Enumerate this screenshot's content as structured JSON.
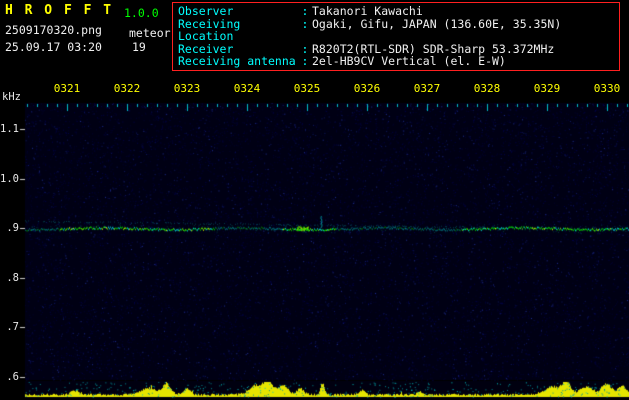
{
  "app": {
    "title": "H R O F F T",
    "version": "1.0.0",
    "filename": "2509170320.png",
    "mode": "meteor",
    "datetime": "25.09.17 03:20",
    "echo_count": "19"
  },
  "station": {
    "separator": ":",
    "rows": [
      {
        "label": "Observer",
        "value": "Takanori Kawachi"
      },
      {
        "label": "Receiving Location",
        "value": "Ogaki, Gifu, JAPAN (136.60E, 35.35N)"
      },
      {
        "label": "Receiver",
        "value": "R820T2(RTL-SDR) SDR-Sharp 53.372MHz"
      },
      {
        "label": "Receiving antenna",
        "value": "2el-HB9CV Vertical (el. E-W)"
      }
    ]
  },
  "spectrogram": {
    "unit": "kHz",
    "time_labels": [
      "0321",
      "0322",
      "0323",
      "0324",
      "0325",
      "0326",
      "0327",
      "0328",
      "0329",
      "0330"
    ],
    "freq_labels": [
      "1.1",
      "1.0",
      ".9",
      ".8",
      ".7",
      ".6"
    ],
    "signal_freq_khz": 0.9
  },
  "colors": {
    "title": "#ffff00",
    "version": "#00ff00",
    "info_label": "#00ffff",
    "info_value": "#f0f0f0",
    "time_label": "#ffff00",
    "box_border": "#ff2020",
    "signal_green": "#00b800",
    "signal_cyan": "#00c4c4",
    "tick_cyan": "#00c0c8",
    "audio_bar": "#e6e600",
    "plot_background": "#000014"
  }
}
